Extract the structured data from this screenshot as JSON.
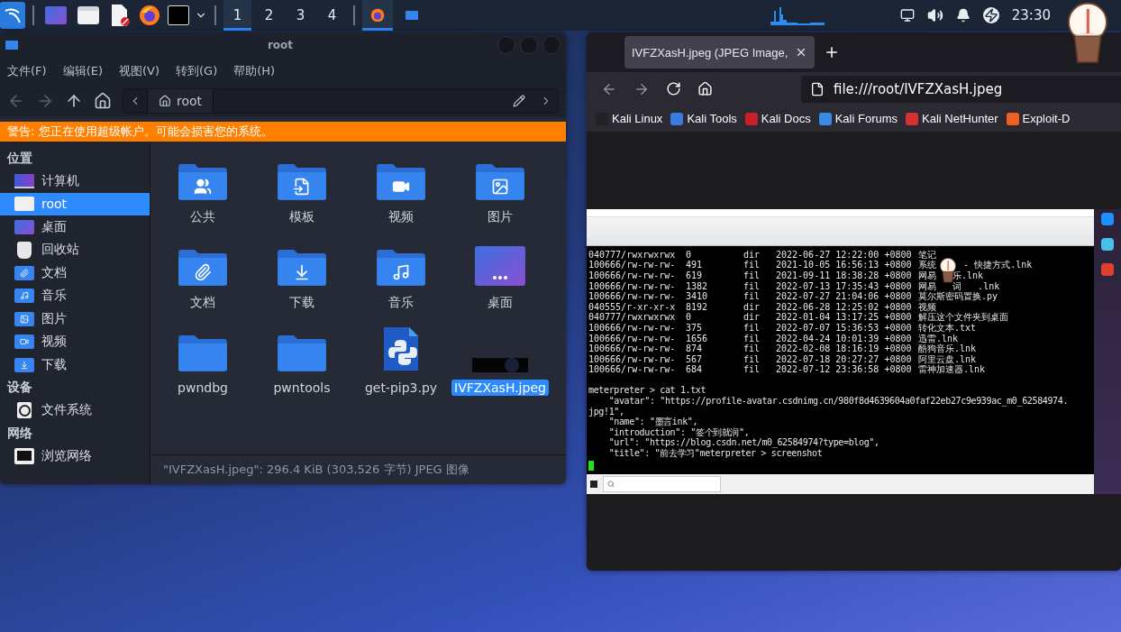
{
  "taskbar": {
    "launchers": [
      {
        "kind": "desktop"
      },
      {
        "kind": "files"
      },
      {
        "kind": "editor"
      },
      {
        "kind": "browser"
      },
      {
        "kind": "terminal"
      }
    ],
    "workspaces": [
      {
        "label": "1",
        "selected": true
      },
      {
        "label": "2",
        "selected": false
      },
      {
        "label": "3",
        "selected": false
      },
      {
        "label": "4",
        "selected": false
      }
    ],
    "tasks": [
      {
        "kind": "browser",
        "selected": true
      },
      {
        "kind": "files",
        "selected": false
      }
    ],
    "clock": "23:30"
  },
  "file_manager": {
    "title": "root",
    "menu": [
      "文件(F)",
      "编辑(E)",
      "视图(V)",
      "转到(G)",
      "帮助(H)"
    ],
    "path": "root",
    "warning": "警告: 您正在使用超级帐户。可能会损害您的系统。",
    "sidebar": [
      {
        "heading": "位置",
        "items": [
          {
            "label": "计算机",
            "kind": "computer",
            "selected": false
          },
          {
            "label": "root",
            "kind": "home",
            "selected": true
          },
          {
            "label": "桌面",
            "kind": "desktop",
            "selected": false
          },
          {
            "label": "回收站",
            "kind": "trash",
            "selected": false
          },
          {
            "label": "文档",
            "kind": "documents",
            "selected": false
          },
          {
            "label": "音乐",
            "kind": "music",
            "selected": false
          },
          {
            "label": "图片",
            "kind": "pictures",
            "selected": false
          },
          {
            "label": "视频",
            "kind": "videos",
            "selected": false
          },
          {
            "label": "下载",
            "kind": "downloads",
            "selected": false
          }
        ]
      },
      {
        "heading": "设备",
        "items": [
          {
            "label": "文件系统",
            "kind": "drive",
            "selected": false
          }
        ]
      },
      {
        "heading": "网络",
        "items": [
          {
            "label": "浏览网络",
            "kind": "network",
            "selected": false
          }
        ]
      }
    ],
    "files": [
      {
        "label": "公共",
        "kind": "public",
        "selected": false
      },
      {
        "label": "模板",
        "kind": "templates",
        "selected": false
      },
      {
        "label": "视频",
        "kind": "videos",
        "selected": false
      },
      {
        "label": "图片",
        "kind": "pictures",
        "selected": false
      },
      {
        "label": "文档",
        "kind": "documents",
        "selected": false
      },
      {
        "label": "下载",
        "kind": "downloads",
        "selected": false
      },
      {
        "label": "音乐",
        "kind": "music",
        "selected": false
      },
      {
        "label": "桌面",
        "kind": "desktop",
        "selected": false
      },
      {
        "label": "pwndbg",
        "kind": "folder",
        "selected": false
      },
      {
        "label": "pwntools",
        "kind": "folder",
        "selected": false
      },
      {
        "label": "get-pip3.py",
        "kind": "python",
        "selected": false
      },
      {
        "label": "IVFZXasH.jpeg",
        "kind": "image",
        "selected": true
      }
    ],
    "status": "\"IVFZXasH.jpeg\": 296.4 KiB (303,526 字节) JPEG 图像"
  },
  "browser": {
    "tab_title": "IVFZXasH.jpeg (JPEG Image,",
    "url": "file:///root/IVFZXasH.jpeg",
    "bookmarks": [
      "Kali Linux",
      "Kali Tools",
      "Kali Docs",
      "Kali Forums",
      "Kali NetHunter",
      "Exploit-D"
    ],
    "image": {
      "rows": [
        {
          "mode": "040777/rwxrwxrwx",
          "size": "0",
          "type": "dir",
          "modified": "2022-06-27 12:22:00 +0800",
          "name": "笔记"
        },
        {
          "mode": "100666/rw-rw-rw-",
          "size": "491",
          "type": "fil",
          "modified": "2021-10-05 16:56:13 +0800",
          "name": "系统     - 快捷方式.lnk"
        },
        {
          "mode": "100666/rw-rw-rw-",
          "size": "619",
          "type": "fil",
          "modified": "2021-09-11 18:38:28 +0800",
          "name": "网易   乐.lnk"
        },
        {
          "mode": "100666/rw-rw-rw-",
          "size": "1382",
          "type": "fil",
          "modified": "2022-07-13 17:35:43 +0800",
          "name": "网易   词   .lnk"
        },
        {
          "mode": "100666/rw-rw-rw-",
          "size": "3410",
          "type": "fil",
          "modified": "2022-07-27 21:04:06 +0800",
          "name": "莫尔斯密码置换.py"
        },
        {
          "mode": "040555/r-xr-xr-x",
          "size": "8192",
          "type": "dir",
          "modified": "2022-06-28 12:25:02 +0800",
          "name": "视频"
        },
        {
          "mode": "040777/rwxrwxrwx",
          "size": "0",
          "type": "dir",
          "modified": "2022-01-04 13:17:25 +0800",
          "name": "解压这个文件夹到桌面"
        },
        {
          "mode": "100666/rw-rw-rw-",
          "size": "375",
          "type": "fil",
          "modified": "2022-07-07 15:36:53 +0800",
          "name": "转化文本.txt"
        },
        {
          "mode": "100666/rw-rw-rw-",
          "size": "1656",
          "type": "fil",
          "modified": "2022-04-24 10:01:39 +0800",
          "name": "迅雷.lnk"
        },
        {
          "mode": "100666/rw-rw-rw-",
          "size": "874",
          "type": "fil",
          "modified": "2022-02-08 18:16:19 +0800",
          "name": "酷狗音乐.lnk"
        },
        {
          "mode": "100666/rw-rw-rw-",
          "size": "567",
          "type": "fil",
          "modified": "2022-07-18 20:27:27 +0800",
          "name": "阿里云盘.lnk"
        },
        {
          "mode": "100666/rw-rw-rw-",
          "size": "684",
          "type": "fil",
          "modified": "2022-07-12 23:36:58 +0800",
          "name": "雷神加速器.lnk"
        }
      ],
      "output": [
        "meterpreter > cat 1.txt",
        "    \"avatar\": \"https://profile-avatar.csdnimg.cn/980f8d4639604a0faf22eb27c9e939ac_m0_62584974.",
        "jpg!1\",",
        "    \"name\": \"墨言ink\",",
        "    \"introduction\": \"签个到就润\",",
        "    \"url\": \"https://blog.csdn.net/m0_62584974?type=blog\",",
        "    \"title\": \"前去学习\"meterpreter > screenshot"
      ],
      "desktop_icons": [
        {
          "kind": "edge"
        },
        {
          "kind": "recorder"
        },
        {
          "kind": "shell"
        }
      ]
    }
  }
}
